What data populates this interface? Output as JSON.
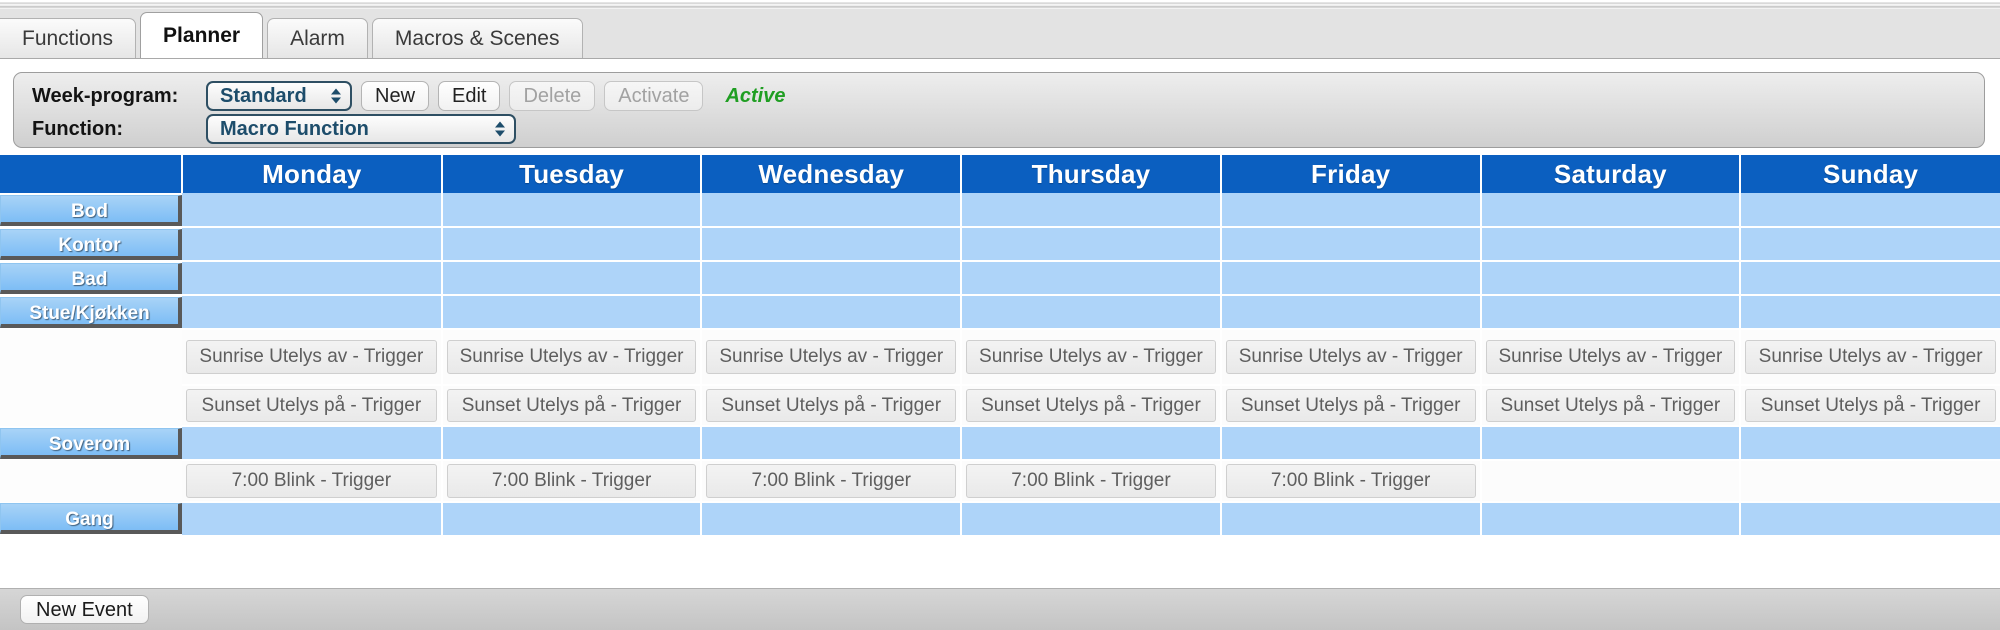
{
  "tabs": [
    {
      "label": "Functions",
      "active": false
    },
    {
      "label": "Planner",
      "active": true
    },
    {
      "label": "Alarm",
      "active": false
    },
    {
      "label": "Macros & Scenes",
      "active": false
    }
  ],
  "toolbar": {
    "week_program_label": "Week-program:",
    "week_program_value": "Standard",
    "new_label": "New",
    "edit_label": "Edit",
    "delete_label": "Delete",
    "activate_label": "Activate",
    "status_label": "Active",
    "status_color": "#1f9e22",
    "function_label": "Function:",
    "function_value": "Macro Function"
  },
  "grid": {
    "corner_label": "",
    "days": [
      "Monday",
      "Tuesday",
      "Wednesday",
      "Thursday",
      "Friday",
      "Saturday",
      "Sunday"
    ],
    "header_color": "#0b5fc0",
    "empty_cell_color": "#aed4f9",
    "rows": [
      {
        "label": "Bod",
        "kind": "room",
        "cells": [
          "",
          "",
          "",
          "",
          "",
          "",
          ""
        ]
      },
      {
        "label": "Kontor",
        "kind": "room",
        "cells": [
          "",
          "",
          "",
          "",
          "",
          "",
          ""
        ]
      },
      {
        "label": "Bad",
        "kind": "room",
        "cells": [
          "",
          "",
          "",
          "",
          "",
          "",
          ""
        ]
      },
      {
        "label": "Stue/Kjøkken",
        "kind": "room",
        "cells": [
          "",
          "",
          "",
          "",
          "",
          "",
          ""
        ]
      },
      {
        "label": "",
        "kind": "sun",
        "cells": [
          "Sunrise Utelys av - Trigger",
          "Sunrise Utelys av - Trigger",
          "Sunrise Utelys av - Trigger",
          "Sunrise Utelys av - Trigger",
          "Sunrise Utelys av - Trigger",
          "Sunrise Utelys av - Trigger",
          "Sunrise Utelys av - Trigger"
        ]
      },
      {
        "label": "",
        "kind": "set",
        "cells": [
          "Sunset Utelys på - Trigger",
          "Sunset Utelys på - Trigger",
          "Sunset Utelys på - Trigger",
          "Sunset Utelys på - Trigger",
          "Sunset Utelys på - Trigger",
          "Sunset Utelys på - Trigger",
          "Sunset Utelys på - Trigger"
        ]
      },
      {
        "label": "Soverom",
        "kind": "room",
        "cells": [
          "",
          "",
          "",
          "",
          "",
          "",
          ""
        ]
      },
      {
        "label": "",
        "kind": "blink",
        "cells": [
          "7:00 Blink - Trigger",
          "7:00 Blink - Trigger",
          "7:00 Blink - Trigger",
          "7:00 Blink - Trigger",
          "7:00 Blink - Trigger",
          "",
          ""
        ]
      },
      {
        "label": "Gang",
        "kind": "room",
        "cells": [
          "",
          "",
          "",
          "",
          "",
          "",
          ""
        ]
      }
    ]
  },
  "bottom": {
    "new_event_label": "New Event"
  }
}
